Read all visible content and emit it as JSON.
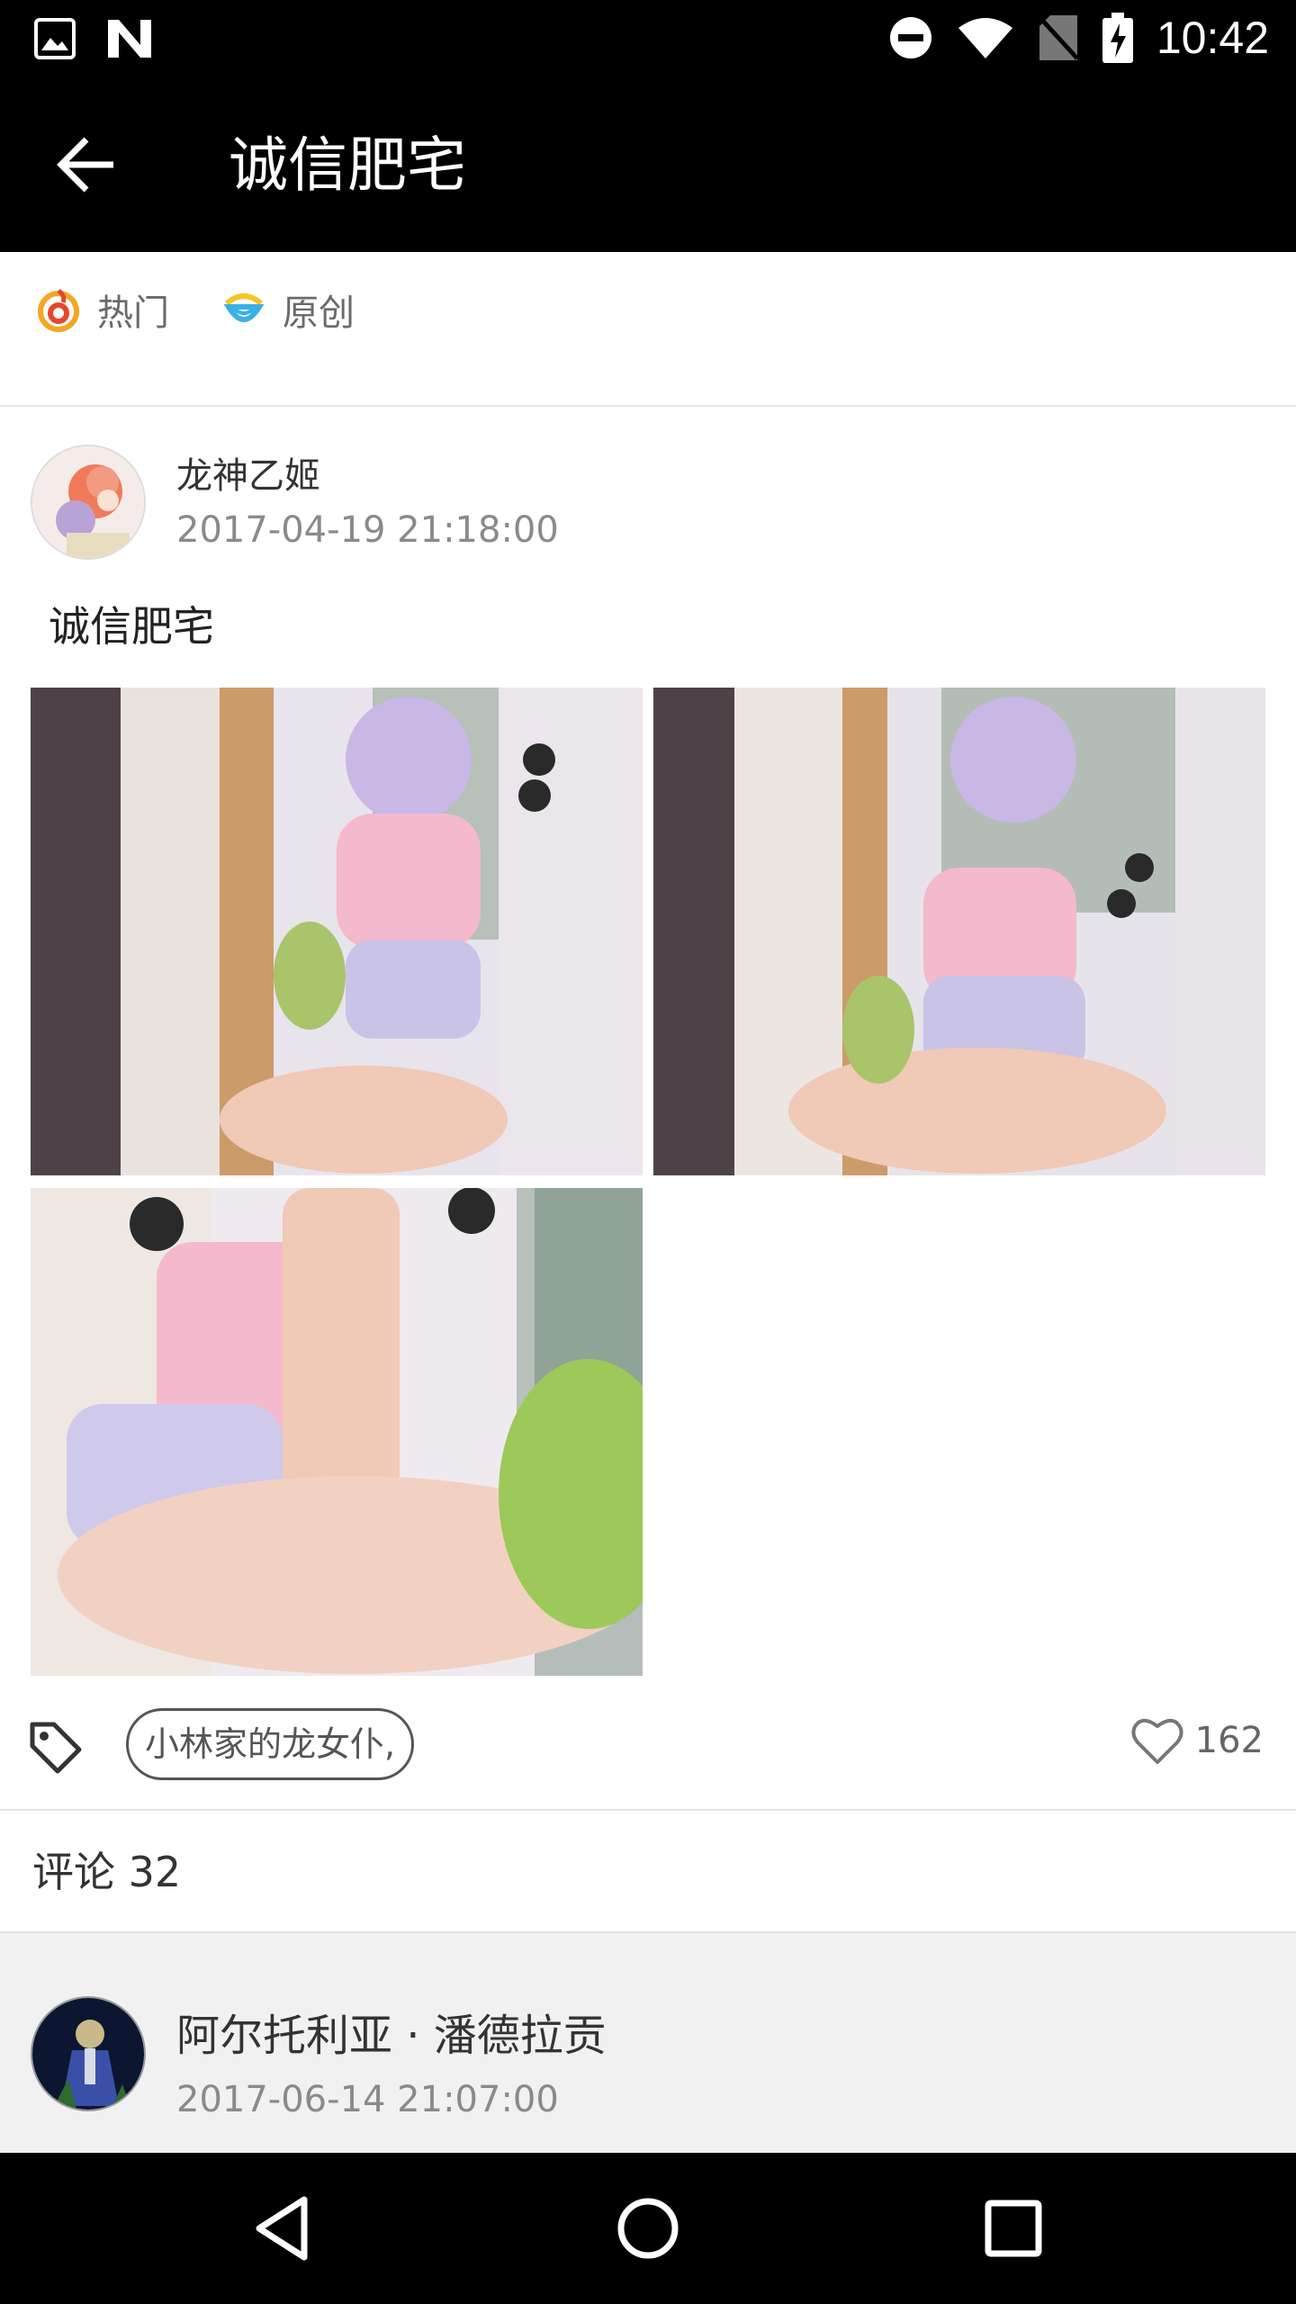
{
  "status_bar": {
    "time": "10:42",
    "icons": [
      "image-icon",
      "n-icon",
      "dnd-icon",
      "wifi-icon",
      "no-sim-icon",
      "battery-charging-icon"
    ]
  },
  "toolbar": {
    "title": "诚信肥宅",
    "back_icon": "arrow-left-icon"
  },
  "categories": [
    {
      "label": "热门",
      "icon": "flame-icon",
      "color": "#f5a623"
    },
    {
      "label": "原创",
      "icon": "original-icon",
      "color": "#3ab0e6"
    }
  ],
  "post": {
    "author": "龙神乙姬",
    "time": "2017-04-19 21:18:00",
    "text": "诚信肥宅",
    "image_count": 3,
    "tag": "小林家的龙女仆,",
    "likes": "162"
  },
  "comments": {
    "header": "评论 32",
    "items": [
      {
        "author": "阿尔托利亚 · 潘德拉贡",
        "time": "2017-06-14 21:07:00"
      }
    ]
  },
  "nav_bar": {
    "buttons": [
      "nav-back-icon",
      "nav-home-icon",
      "nav-recents-icon"
    ]
  }
}
